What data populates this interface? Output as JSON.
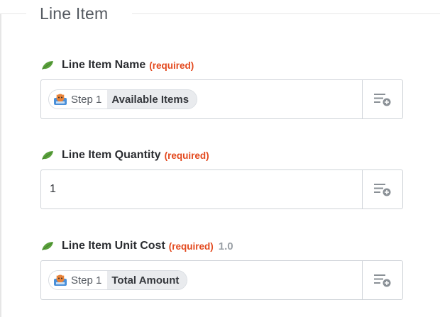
{
  "section": {
    "title": "Line Item"
  },
  "fields": [
    {
      "label": "Line Item Name",
      "required": "(required)",
      "default": "",
      "value_type": "mapped",
      "pill_step": "Step 1",
      "pill_value": "Available Items"
    },
    {
      "label": "Line Item Quantity",
      "required": "(required)",
      "default": "",
      "value_type": "text",
      "value": "1"
    },
    {
      "label": "Line Item Unit Cost",
      "required": "(required)",
      "default": "1.0",
      "value_type": "mapped",
      "pill_step": "Step 1",
      "pill_value": "Total Amount"
    }
  ],
  "icons": {
    "label_icon": "leaf-icon",
    "pill_icon": "app-mascot-icon",
    "insert_icon": "insert-data-icon"
  },
  "colors": {
    "required": "#e3491e",
    "leaf": "#5aa03c",
    "title": "#555a61"
  }
}
